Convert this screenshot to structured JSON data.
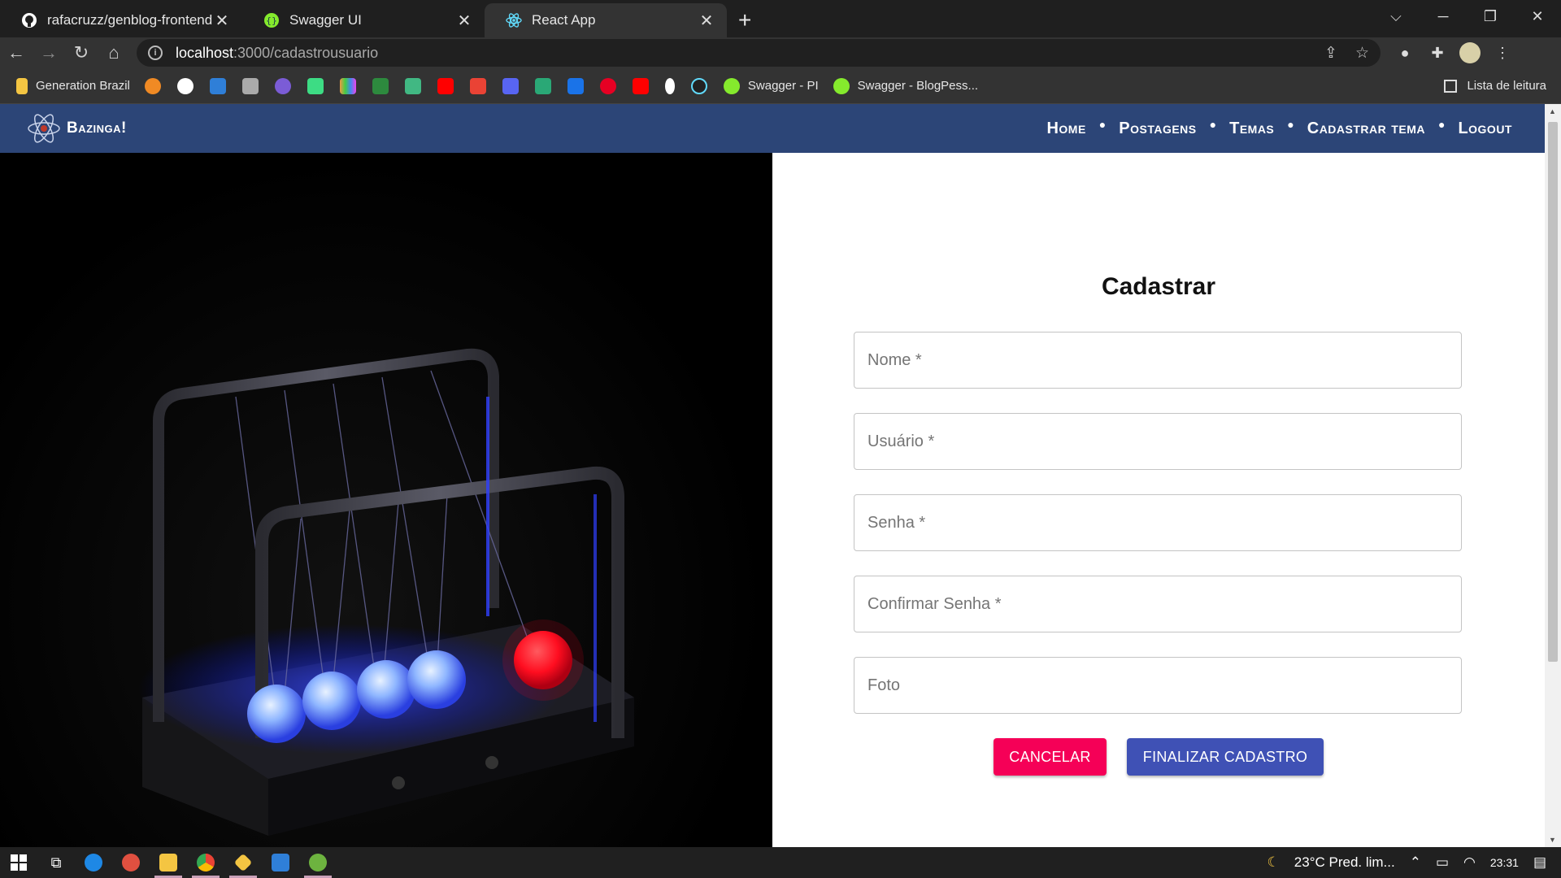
{
  "browser": {
    "tabs": [
      {
        "title": "rafacruzz/genblog-frontend",
        "icon": "github-icon",
        "active": false
      },
      {
        "title": "Swagger UI",
        "icon": "swagger-icon",
        "active": false
      },
      {
        "title": "React App",
        "icon": "react-icon",
        "active": true
      }
    ],
    "url_host": "localhost",
    "url_path": ":3000/cadastrousuario",
    "bookmarks": {
      "first_label": "Generation Brazil",
      "swagger_pi": "Swagger - PI",
      "swagger_blog": "Swagger - BlogPess...",
      "reading_list": "Lista de leitura"
    }
  },
  "app": {
    "brand": "Bazinga!",
    "menu": [
      "Home",
      "Postagens",
      "Temas",
      "Cadastrar tema",
      "Logout"
    ],
    "colors": {
      "appbar": "#2c4577",
      "cancel": "#f50057",
      "submit": "#3f51b5"
    }
  },
  "form": {
    "title": "Cadastrar",
    "fields": [
      {
        "placeholder": "Nome *"
      },
      {
        "placeholder": "Usuário *"
      },
      {
        "placeholder": "Senha *"
      },
      {
        "placeholder": "Confirmar Senha *"
      },
      {
        "placeholder": "Foto"
      }
    ],
    "cancel_label": "CANCELAR",
    "submit_label": "FINALIZAR CADASTRO"
  },
  "taskbar": {
    "weather": "23°C  Pred. lim...",
    "time": "23:31"
  }
}
